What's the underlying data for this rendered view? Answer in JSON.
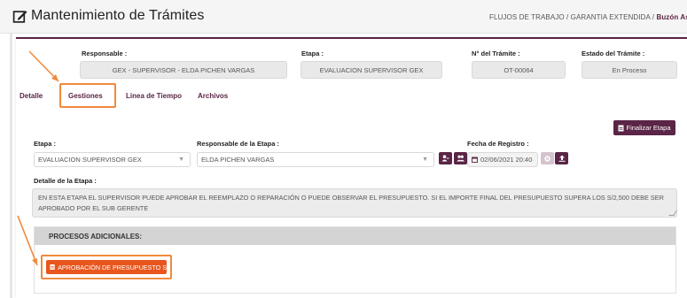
{
  "header": {
    "title": "Mantenimiento de Trámites",
    "breadcrumb_path": "FLUJOS DE TRABAJO / GARANTIA EXTENDIDA / ",
    "breadcrumb_current": "Buzón Asignad"
  },
  "summary": {
    "responsable_label": "Responsable :",
    "responsable_value": "GEX - SUPERVISOR - ELDA PICHEN VARGAS",
    "etapa_label": "Etapa :",
    "etapa_value": "EVALUACION SUPERVISOR GEX",
    "numero_label": "N° del Trámite :",
    "numero_value": "OT-00064",
    "estado_label": "Estado del Trámite :",
    "estado_value": "En Proceso"
  },
  "tabs": [
    {
      "label": "Detalle"
    },
    {
      "label": "Gestiones"
    },
    {
      "label": "Linea de Tiempo"
    },
    {
      "label": "Archivos"
    }
  ],
  "gestiones": {
    "finalizar_label": "Finalizar Etapa",
    "etapa_label": "Etapa :",
    "etapa_value": "EVALUACION SUPERVISOR GEX",
    "responsable_label": "Responsable de la Etapa :",
    "responsable_value": "ELDA PICHEN VARGAS",
    "fecha_label": "Fecha de Registro :",
    "fecha_value": "02/06/2021 20:40",
    "detalle_label": "Detalle de la Etapa :",
    "detalle_value": "EN ESTA ETAPA EL SUPERVISOR PUEDE APROBAR EL REEMPLAZO O REPARACIÓN O PUEDE OBSERVAR EL PRESUPUESTO. SI EL IMPORTE FINAL DEL PRESUPUESTO SUPERA LOS S/2,500 DEBE SER APROBADO POR EL SUB GERENTE"
  },
  "procesos": {
    "header": "PROCESOS ADICIONALES:",
    "button_label": "APROBACIÓN DE PRESUPUESTO S"
  },
  "colors": {
    "brand": "#5a2546",
    "orange": "#e8561e",
    "annotation": "#f08a3e"
  }
}
